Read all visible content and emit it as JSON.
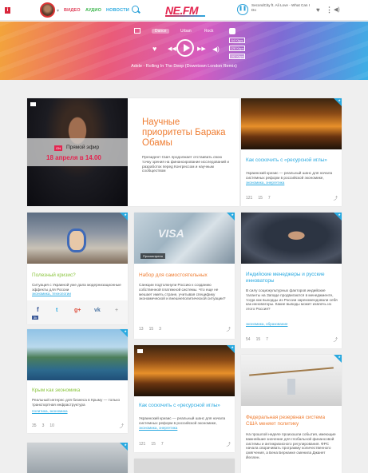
{
  "header": {
    "nav_video": "ВИДЕО",
    "nav_audio": "АУДИО",
    "nav_news": "НОВОСТИ",
    "brand": "NE.FM",
    "now_playing": "SecondCity ft. Ali Love - What Can I Do"
  },
  "player": {
    "genres": [
      "Dance",
      "Urban",
      "Rock"
    ],
    "bitrates": [
      "64 Kbps",
      "128 Kbps",
      "192 Kbps"
    ],
    "track": "Adele - Rolling In The Deep (Downtown London Remix)"
  },
  "cards": {
    "obama": {
      "live_badge": "ON",
      "live_label": "Прямой эфир",
      "date": "18 апреля в 14.00",
      "title": "Научные приоритеты Барака Обамы",
      "text": "Президент США продолжает отстаивать свою точку зрения на финансирование исследований и разработок перед Конгрессом и научным сообществом"
    },
    "oil1": {
      "title": "Как соскочить с «ресурсной иглы»",
      "text": "Украинский кризис — реальный шанс для начала системных реформ в российской экономике,",
      "tags": "экономика, энергетика",
      "views": "121",
      "comments": "15",
      "likes": "7"
    },
    "crisis": {
      "title": "Полезный кризис?",
      "text": "Ситуация с Украиной уже дала модернизационные эффекты для России",
      "tags": "экономика, технологии",
      "share_count": "3k",
      "social": [
        "f",
        "t",
        "g+",
        "vk",
        "+"
      ]
    },
    "visa": {
      "badge": "Просмотрено",
      "title": "Набор для самостоятельных",
      "text": "Санкции подтолкнули Россию к созданию собственной платежной системы. Что еще не мешает иметь стране, учитывая специфику экономической и внешнеполитической ситуации?",
      "views": "13",
      "comments": "15",
      "likes": "3"
    },
    "india": {
      "title": "Индийские менеджеры и русские инноваторы",
      "text": "В силу социокультурных факторов индийские таланты на Западе продвигаются в менеджменте, тогда как выходцы из России зарекомендовали себя как инноваторы. Какие выводы может извлечь из этого Россия?",
      "tags": "экономика, образование",
      "views": "54",
      "comments": "15",
      "likes": "7"
    },
    "crimea": {
      "title": "Крым как экономика",
      "text": "Реальный интерес для бизнеса в Крыму — только транспортная инфраструктура",
      "tags": "политика, экономика",
      "views": "35",
      "comments": "3",
      "likes": "10"
    },
    "oil2": {
      "title": "Как соскочить с «ресурсной иглы»",
      "text": "Украинский кризис — реальный шанс для начала системных реформ в российской экономике,",
      "tags": "экономика, энергетика",
      "views": "121",
      "comments": "15",
      "likes": "7"
    },
    "fed": {
      "title": "Федеральная резервная система США меняет политику",
      "text": "На прошлой неделе произошли события, имеющие важнейшие значение для глобальной финансовой системы и антикризисного регулирования. ФРС начала сворачивать программу количественного смягчения, а Бена Бернанке сменила Джанет Йеллен."
    }
  }
}
